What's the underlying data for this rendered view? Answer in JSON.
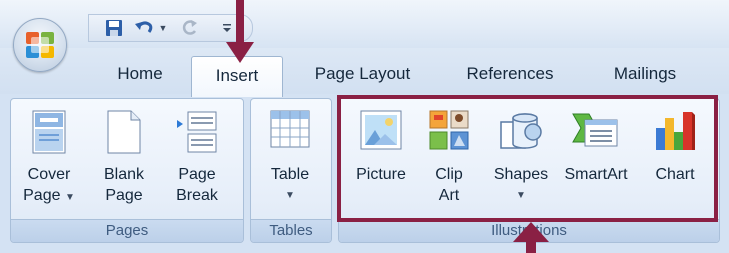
{
  "tabs": [
    "Home",
    "Insert",
    "Page Layout",
    "References",
    "Mailings"
  ],
  "active_tab": "Insert",
  "groups": {
    "pages": {
      "label": "Pages",
      "cover_page": {
        "line1": "Cover",
        "line2": "Page"
      },
      "blank_page": {
        "line1": "Blank",
        "line2": "Page"
      },
      "page_break": {
        "line1": "Page",
        "line2": "Break"
      }
    },
    "tables": {
      "label": "Tables",
      "table": {
        "line1": "Table"
      }
    },
    "illustrations": {
      "label": "Illustrations",
      "picture": {
        "line1": "Picture"
      },
      "clip_art": {
        "line1": "Clip",
        "line2": "Art"
      },
      "shapes": {
        "line1": "Shapes"
      },
      "smartart": {
        "line1": "SmartArt"
      },
      "chart": {
        "line1": "Chart"
      }
    }
  },
  "icons": {
    "office_button": "office-logo-icon",
    "qat": [
      "save-icon",
      "undo-icon",
      "redo-icon",
      "customize-qat-icon"
    ]
  },
  "colors": {
    "annotation": "#8a2044",
    "ribbon_background": "#d4e2f3",
    "tab_text": "#15283c"
  }
}
